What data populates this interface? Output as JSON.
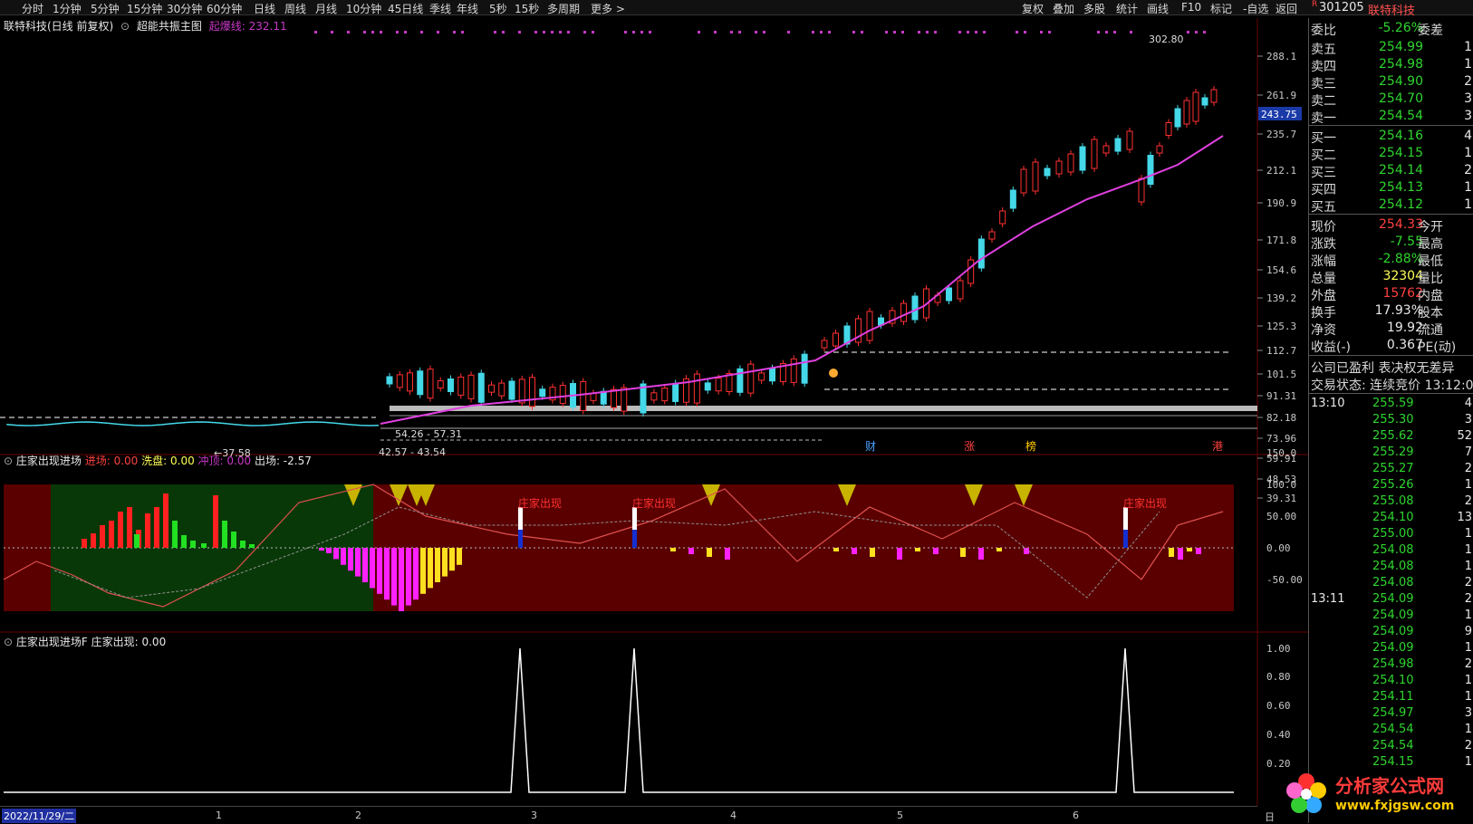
{
  "toolbar": {
    "period_tabs": [
      "分时",
      "1分钟",
      "5分钟",
      "15分钟",
      "30分钟",
      "60分钟",
      "日线",
      "周线",
      "月线",
      "10分钟",
      "45日线",
      "季线",
      "年线",
      "5秒",
      "15秒",
      "多周期",
      "更多 >"
    ],
    "right_tools": [
      "复权",
      "叠加",
      "多股",
      "统计",
      "画线",
      "F10",
      "标记",
      "-自选",
      "返回"
    ],
    "stock_code": "301205",
    "stock_name": "联特科技"
  },
  "main_chart": {
    "title_left": "联特科技(日线 前复权)",
    "indicator_name": "超能共振主图",
    "indicator_label": "起爆线: 232.11",
    "price_axis": [
      "288.1",
      "261.9",
      "235.7",
      "212.1",
      "190.9",
      "171.8",
      "154.6",
      "139.2",
      "125.3",
      "112.7",
      "101.5",
      "91.31",
      "82.18",
      "73.96",
      "59.91",
      "48.53",
      "39.31"
    ],
    "current_price_tag": "243.75",
    "high_label": "302.80",
    "range_labels": [
      "54.26 - 57.31",
      "42.57 - 43.54",
      "37.58"
    ],
    "event_markers": [
      "财",
      "涨",
      "榜",
      "港"
    ],
    "event_colors": [
      "#4aa0ff",
      "#ff4040",
      "#ffcc00",
      "#ff4040"
    ]
  },
  "indicator1": {
    "title": "庄家出现进场",
    "enter_label": "进场: 0.00",
    "wash_label": "洗盘: 0.00",
    "top_label": "冲顶: 0.00",
    "exit_label": "出场: -2.57",
    "axis": [
      "150.0",
      "100.0",
      "50.00",
      "0.00",
      "-50.00"
    ],
    "event_text": "庄家出现"
  },
  "indicator2": {
    "title": "庄家出现进场F",
    "value_label": "庄家出现: 0.00",
    "axis": [
      "1.00",
      "0.80",
      "0.60",
      "0.40",
      "0.20"
    ]
  },
  "date_axis": {
    "current_date": "2022/11/29/二",
    "months": [
      "1",
      "2",
      "3",
      "4",
      "5",
      "6"
    ],
    "end_label": "日"
  },
  "quote": {
    "weibi_label": "委比",
    "weibi_val": "-5.26%",
    "weicha_label": "委差",
    "asks": [
      {
        "label": "卖五",
        "price": "254.99",
        "vol": "1"
      },
      {
        "label": "卖四",
        "price": "254.98",
        "vol": "1"
      },
      {
        "label": "卖三",
        "price": "254.90",
        "vol": "2"
      },
      {
        "label": "卖二",
        "price": "254.70",
        "vol": "3"
      },
      {
        "label": "卖一",
        "price": "254.54",
        "vol": "3"
      }
    ],
    "bids": [
      {
        "label": "买一",
        "price": "254.16",
        "vol": "4"
      },
      {
        "label": "买二",
        "price": "254.15",
        "vol": "1"
      },
      {
        "label": "买三",
        "price": "254.14",
        "vol": "2"
      },
      {
        "label": "买四",
        "price": "254.13",
        "vol": "1"
      },
      {
        "label": "买五",
        "price": "254.12",
        "vol": "1"
      }
    ],
    "stats": [
      {
        "l1": "现价",
        "v1": "254.33",
        "c1": "r",
        "l2": "今开"
      },
      {
        "l1": "涨跌",
        "v1": "-7.55",
        "c1": "g",
        "l2": "最高"
      },
      {
        "l1": "涨幅",
        "v1": "-2.88%",
        "c1": "g",
        "l2": "最低"
      },
      {
        "l1": "总量",
        "v1": "32304",
        "c1": "y",
        "l2": "量比"
      },
      {
        "l1": "外盘",
        "v1": "15762",
        "c1": "r",
        "l2": "内盘"
      },
      {
        "l1": "换手",
        "v1": "17.93%",
        "c1": "w",
        "l2": "股本"
      },
      {
        "l1": "净资",
        "v1": "19.92",
        "c1": "w",
        "l2": "流通"
      },
      {
        "l1": "收益(-)",
        "v1": "0.367",
        "c1": "w",
        "l2": "PE(动)"
      }
    ],
    "notice1": "公司已盈利 表决权无差异",
    "notice2": "交易状态: 连续竞价 13:12:0",
    "ticks": [
      {
        "t": "13:10",
        "p": "255.59",
        "v": "4",
        "c": "g"
      },
      {
        "t": "",
        "p": "255.30",
        "v": "3",
        "c": "g"
      },
      {
        "t": "",
        "p": "255.62",
        "v": "52",
        "c": "g"
      },
      {
        "t": "",
        "p": "255.29",
        "v": "7",
        "c": "g"
      },
      {
        "t": "",
        "p": "255.27",
        "v": "2",
        "c": "g"
      },
      {
        "t": "",
        "p": "255.26",
        "v": "1",
        "c": "g"
      },
      {
        "t": "",
        "p": "255.08",
        "v": "2",
        "c": "g"
      },
      {
        "t": "",
        "p": "254.10",
        "v": "13",
        "c": "g"
      },
      {
        "t": "",
        "p": "255.00",
        "v": "1",
        "c": "g"
      },
      {
        "t": "",
        "p": "254.08",
        "v": "1",
        "c": "g"
      },
      {
        "t": "",
        "p": "254.08",
        "v": "1",
        "c": "g"
      },
      {
        "t": "",
        "p": "254.08",
        "v": "2",
        "c": "g"
      },
      {
        "t": "13:11",
        "p": "254.09",
        "v": "2",
        "c": "g"
      },
      {
        "t": "",
        "p": "254.09",
        "v": "1",
        "c": "g"
      },
      {
        "t": "",
        "p": "254.09",
        "v": "9",
        "c": "g"
      },
      {
        "t": "",
        "p": "254.09",
        "v": "1",
        "c": "g"
      },
      {
        "t": "",
        "p": "254.98",
        "v": "2",
        "c": "g"
      },
      {
        "t": "",
        "p": "254.10",
        "v": "1",
        "c": "g"
      },
      {
        "t": "",
        "p": "254.11",
        "v": "1",
        "c": "g"
      },
      {
        "t": "",
        "p": "254.97",
        "v": "3",
        "c": "g"
      },
      {
        "t": "",
        "p": "254.54",
        "v": "1",
        "c": "g"
      },
      {
        "t": "",
        "p": "254.54",
        "v": "2",
        "c": "g"
      },
      {
        "t": "",
        "p": "254.15",
        "v": "1",
        "c": "g"
      }
    ]
  },
  "logo": {
    "brand": "分析家公式网",
    "url": "www.fxjgsw.com"
  }
}
